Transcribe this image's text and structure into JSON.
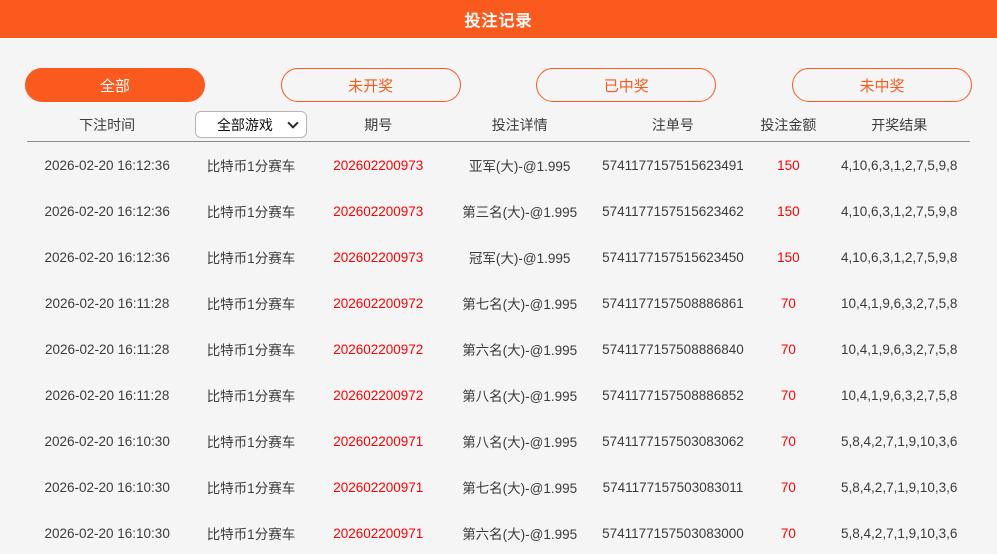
{
  "header": {
    "title": "投注记录"
  },
  "filters": [
    {
      "label": "全部",
      "active": true
    },
    {
      "label": "未开奖",
      "active": false
    },
    {
      "label": "已中奖",
      "active": false
    },
    {
      "label": "未中奖",
      "active": false
    }
  ],
  "table": {
    "columns": {
      "time": "下注时间",
      "period": "期号",
      "details": "投注详情",
      "order": "注单号",
      "amount": "投注金额",
      "result": "开奖结果"
    },
    "game_filter": {
      "selected": "全部游戏"
    },
    "rows": [
      {
        "time": "2026-02-20 16:12:36",
        "game": "比特币1分赛车",
        "period": "202602200973",
        "details": "亚军(大)-@1.995",
        "order": "5741177157515623491",
        "amount": "150",
        "result": "4,10,6,3,1,2,7,5,9,8"
      },
      {
        "time": "2026-02-20 16:12:36",
        "game": "比特币1分赛车",
        "period": "202602200973",
        "details": "第三名(大)-@1.995",
        "order": "5741177157515623462",
        "amount": "150",
        "result": "4,10,6,3,1,2,7,5,9,8"
      },
      {
        "time": "2026-02-20 16:12:36",
        "game": "比特币1分赛车",
        "period": "202602200973",
        "details": "冠军(大)-@1.995",
        "order": "5741177157515623450",
        "amount": "150",
        "result": "4,10,6,3,1,2,7,5,9,8"
      },
      {
        "time": "2026-02-20 16:11:28",
        "game": "比特币1分赛车",
        "period": "202602200972",
        "details": "第七名(大)-@1.995",
        "order": "5741177157508886861",
        "amount": "70",
        "result": "10,4,1,9,6,3,2,7,5,8"
      },
      {
        "time": "2026-02-20 16:11:28",
        "game": "比特币1分赛车",
        "period": "202602200972",
        "details": "第六名(大)-@1.995",
        "order": "5741177157508886840",
        "amount": "70",
        "result": "10,4,1,9,6,3,2,7,5,8"
      },
      {
        "time": "2026-02-20 16:11:28",
        "game": "比特币1分赛车",
        "period": "202602200972",
        "details": "第八名(大)-@1.995",
        "order": "5741177157508886852",
        "amount": "70",
        "result": "10,4,1,9,6,3,2,7,5,8"
      },
      {
        "time": "2026-02-20 16:10:30",
        "game": "比特币1分赛车",
        "period": "202602200971",
        "details": "第八名(大)-@1.995",
        "order": "5741177157503083062",
        "amount": "70",
        "result": "5,8,4,2,7,1,9,10,3,6"
      },
      {
        "time": "2026-02-20 16:10:30",
        "game": "比特币1分赛车",
        "period": "202602200971",
        "details": "第七名(大)-@1.995",
        "order": "5741177157503083011",
        "amount": "70",
        "result": "5,8,4,2,7,1,9,10,3,6"
      },
      {
        "time": "2026-02-20 16:10:30",
        "game": "比特币1分赛车",
        "period": "202602200971",
        "details": "第六名(大)-@1.995",
        "order": "5741177157503083000",
        "amount": "70",
        "result": "5,8,4,2,7,1,9,10,3,6"
      }
    ]
  },
  "colors": {
    "accent": "#fb5a1e",
    "highlight": "#fe0000",
    "background": "#f5f5f6"
  }
}
